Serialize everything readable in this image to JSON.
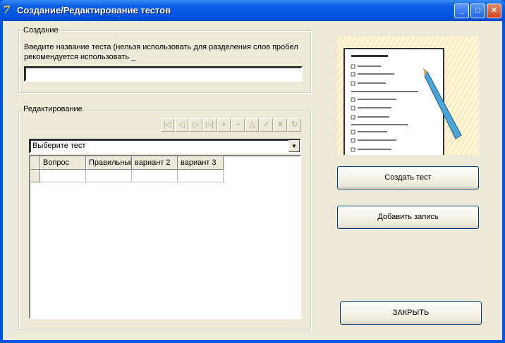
{
  "window": {
    "title": "Создание/Редактирование тестов",
    "icon": "delphi-app-icon",
    "controls": [
      "minimize",
      "maximize",
      "close"
    ]
  },
  "create_group": {
    "label": "Создание",
    "hint_line1": "Введите название теста (нельзя использовать для разделения слов пробел",
    "hint_line2": "рекомендуется использовать _",
    "name_value": ""
  },
  "edit_group": {
    "label": "Редактирование",
    "navigator": [
      {
        "icon": "first-icon",
        "glyph": "|◁"
      },
      {
        "icon": "prior-icon",
        "glyph": "◁"
      },
      {
        "icon": "next-icon",
        "glyph": "▷"
      },
      {
        "icon": "last-icon",
        "glyph": "▷|"
      },
      {
        "icon": "insert-icon",
        "glyph": "+"
      },
      {
        "icon": "delete-icon",
        "glyph": "−"
      },
      {
        "icon": "edit-icon",
        "glyph": "△"
      },
      {
        "icon": "post-icon",
        "glyph": "✓"
      },
      {
        "icon": "cancel-icon",
        "glyph": "✕"
      },
      {
        "icon": "refresh-icon",
        "glyph": "↻"
      }
    ],
    "combo_value": "Выберите тест",
    "grid": {
      "columns": [
        "Вопрос",
        "Правильный",
        "вариант 2",
        "вариант 3"
      ],
      "rows": [
        [
          "",
          "",
          "",
          ""
        ]
      ]
    }
  },
  "buttons": {
    "create": "Создать тест",
    "add": "Добавить запись",
    "close": "ЗАКРЫТЬ"
  }
}
